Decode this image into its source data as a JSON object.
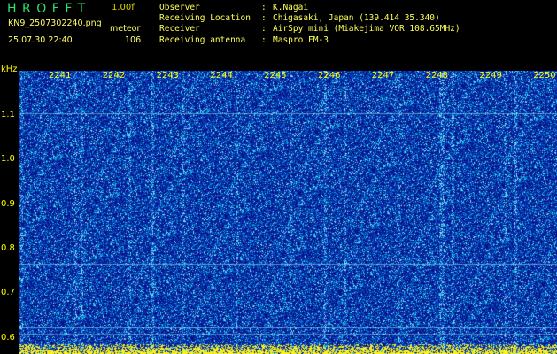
{
  "header": {
    "logo": "HROFFT",
    "version": "1.00f",
    "filename": "KN9_2507302240.png",
    "meteor_label": "meteor",
    "datetime": "25.07.30 22:40",
    "count": "106"
  },
  "info": [
    {
      "key": "Observer",
      "value": "K.Nagai"
    },
    {
      "key": "Receiving Location",
      "value": "Chigasaki, Japan (139.414 35.340)"
    },
    {
      "key": "Receiver",
      "value": "AirSpy mini (Miakejima VOR 108.65MHz)"
    },
    {
      "key": "Receiving antenna",
      "value": "Maspro FM-3"
    }
  ],
  "chart_data": {
    "type": "heatmap",
    "x_ticks": [
      "2241",
      "2242",
      "2243",
      "2244",
      "2245",
      "2246",
      "2247",
      "2248",
      "2249",
      "2250"
    ],
    "y_unit": "kHz",
    "y_ticks": [
      "1.1",
      "1.0",
      "0.9",
      "0.8",
      "0.7",
      "0.6"
    ],
    "colors": {
      "background": "#000000",
      "noise_low": "#0a1aa0",
      "noise_high": "#00c8ff",
      "label": "#ffff00"
    }
  }
}
